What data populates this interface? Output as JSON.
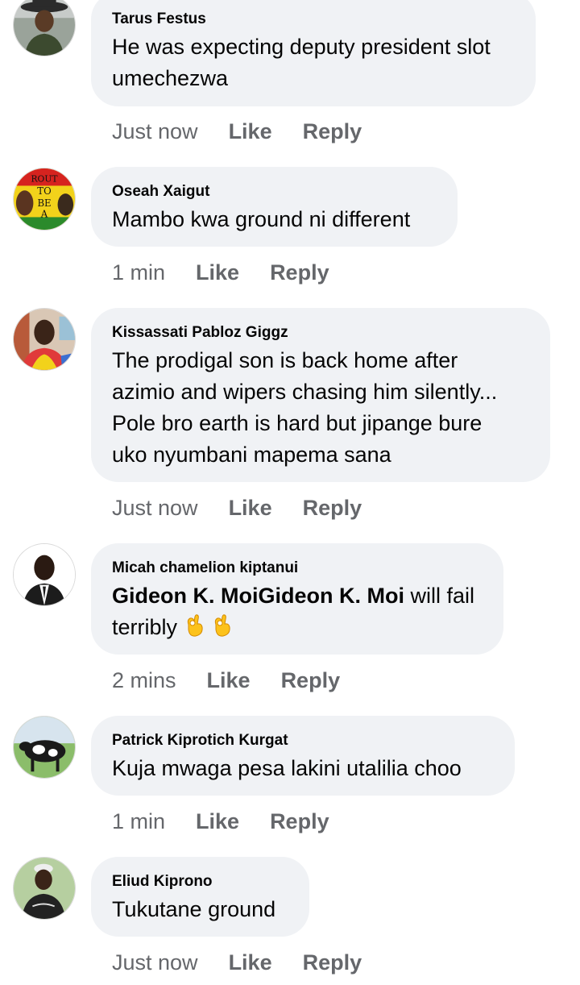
{
  "comments": [
    {
      "author": "Tarus Festus",
      "lines": [
        "He was expecting deputy president slot",
        "umechezwa"
      ],
      "time": "Just now",
      "like": "Like",
      "reply": "Reply"
    },
    {
      "author": "Oseah Xaigut",
      "lines": [
        "Mambo kwa ground ni different"
      ],
      "time": "1 min",
      "like": "Like",
      "reply": "Reply"
    },
    {
      "author": "Kissassati Pabloz Giggz",
      "lines": [
        "The prodigal son is back home after",
        "azimio and wipers chasing him silently...",
        "Pole bro earth is hard but jipange bure",
        "uko nyumbani mapema sana"
      ],
      "time": "Just now",
      "like": "Like",
      "reply": "Reply"
    },
    {
      "author": "Micah chamelion  kiptanui",
      "mention": "Gideon K. MoiGideon K. Moi",
      "after_mention": " will fail",
      "line2": "terribly",
      "time": "2 mins",
      "like": "Like",
      "reply": "Reply"
    },
    {
      "author": "Patrick Kiprotich Kurgat",
      "lines": [
        "Kuja mwaga pesa lakini  utalilia choo"
      ],
      "time": "1 min",
      "like": "Like",
      "reply": "Reply"
    },
    {
      "author": "Eliud Kiprono",
      "lines": [
        "Tukutane ground"
      ],
      "time": "Just now",
      "like": "Like",
      "reply": "Reply"
    }
  ],
  "avatar_badge_text": [
    "ROUT",
    "TO",
    "BE",
    "A"
  ],
  "emoji": [
    "ok-hand-icon",
    "ok-hand-icon"
  ],
  "colors": {
    "bubble_bg": "#f0f2f5",
    "text": "#050505",
    "secondary_text": "#65676b"
  }
}
